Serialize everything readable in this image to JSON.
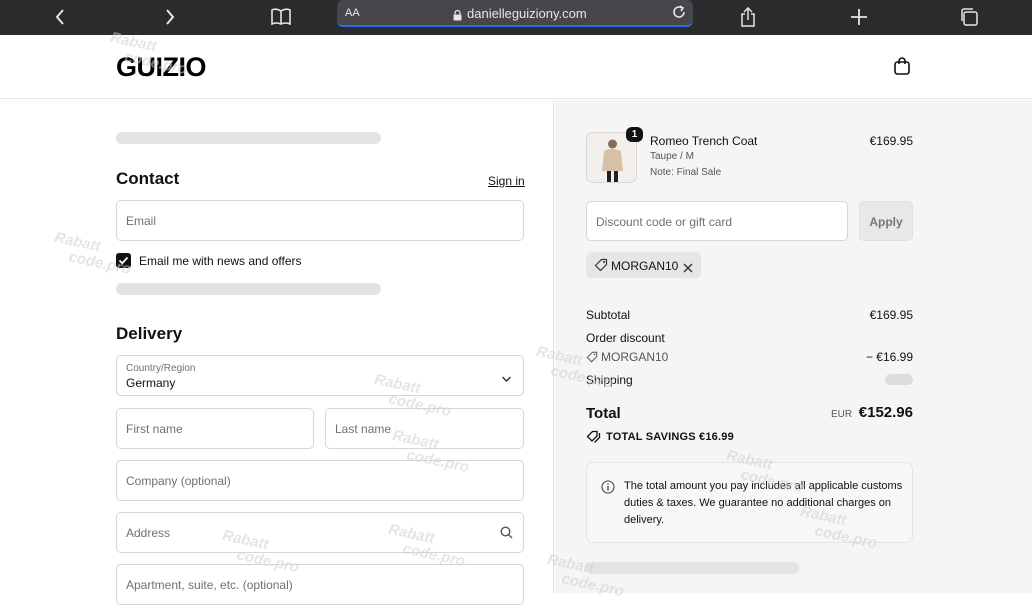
{
  "browser": {
    "text_size_label": "AA",
    "url": "danielleguiziony.com"
  },
  "header": {
    "logo": "GUIZIO"
  },
  "contact": {
    "title": "Contact",
    "sign_in": "Sign in",
    "email_placeholder": "Email",
    "newsletter_label": "Email me with news and offers",
    "newsletter_checked": true
  },
  "delivery": {
    "title": "Delivery",
    "country_label": "Country/Region",
    "country_value": "Germany",
    "first_name_placeholder": "First name",
    "last_name_placeholder": "Last name",
    "company_placeholder": "Company (optional)",
    "address_placeholder": "Address",
    "apartment_placeholder": "Apartment, suite, etc. (optional)"
  },
  "summary": {
    "item": {
      "quantity": "1",
      "name": "Romeo Trench Coat",
      "variant": "Taupe / M",
      "note": "Note: Final Sale",
      "price": "€169.95"
    },
    "discount_placeholder": "Discount code or gift card",
    "apply_label": "Apply",
    "applied_code": "MORGAN10",
    "subtotal_label": "Subtotal",
    "subtotal_value": "€169.95",
    "order_discount_label": "Order discount",
    "discount_code": "MORGAN10",
    "discount_value": "− €16.99",
    "shipping_label": "Shipping",
    "total_label": "Total",
    "currency": "EUR",
    "total_value": "€152.96",
    "savings_label": "TOTAL SAVINGS €16.99",
    "notice": "The total amount you pay includes all applicable customs duties & taxes. We guarantee no additional charges on delivery."
  },
  "watermark": {
    "line1": "Rabatt",
    "line2": "code.pro"
  }
}
